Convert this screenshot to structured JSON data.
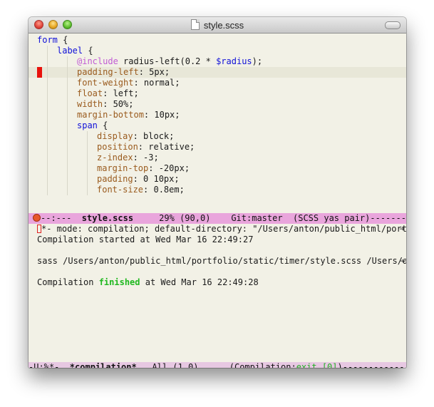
{
  "window": {
    "title": "style.scss"
  },
  "code": {
    "lines": [
      {
        "indent": 0,
        "parts": [
          {
            "t": "form",
            "c": "kw"
          },
          {
            "t": " {"
          }
        ]
      },
      {
        "indent": 1,
        "parts": [
          {
            "t": "label",
            "c": "kw"
          },
          {
            "t": " {"
          }
        ]
      },
      {
        "indent": 2,
        "parts": [
          {
            "t": "@include",
            "c": "inc"
          },
          {
            "t": " radius-left(0.2 * "
          },
          {
            "t": "$radius",
            "c": "var"
          },
          {
            "t": ");"
          }
        ]
      },
      {
        "indent": 2,
        "hl": true,
        "marker": true,
        "parts": [
          {
            "t": "padding-left",
            "c": "prop"
          },
          {
            "t": ": 5px;"
          }
        ]
      },
      {
        "indent": 2,
        "parts": [
          {
            "t": "font-weight",
            "c": "prop"
          },
          {
            "t": ": normal;"
          }
        ]
      },
      {
        "indent": 2,
        "parts": [
          {
            "t": "float",
            "c": "prop"
          },
          {
            "t": ": left;"
          }
        ]
      },
      {
        "indent": 2,
        "parts": [
          {
            "t": "width",
            "c": "prop"
          },
          {
            "t": ": 50%;"
          }
        ]
      },
      {
        "indent": 2,
        "parts": [
          {
            "t": "margin-bottom",
            "c": "prop"
          },
          {
            "t": ": 10px;"
          }
        ]
      },
      {
        "indent": 2,
        "parts": [
          {
            "t": "span",
            "c": "kw"
          },
          {
            "t": " {"
          }
        ]
      },
      {
        "indent": 3,
        "parts": [
          {
            "t": "display",
            "c": "prop"
          },
          {
            "t": ": block;"
          }
        ]
      },
      {
        "indent": 3,
        "parts": [
          {
            "t": "position",
            "c": "prop"
          },
          {
            "t": ": relative;"
          }
        ]
      },
      {
        "indent": 3,
        "parts": [
          {
            "t": "z-index",
            "c": "prop"
          },
          {
            "t": ": -3;"
          }
        ]
      },
      {
        "indent": 3,
        "parts": [
          {
            "t": "margin-top",
            "c": "prop"
          },
          {
            "t": ": -20px;"
          }
        ]
      },
      {
        "indent": 3,
        "parts": [
          {
            "t": "padding",
            "c": "prop"
          },
          {
            "t": ": 0 10px;"
          }
        ]
      },
      {
        "indent": 3,
        "parts": [
          {
            "t": "font-size",
            "c": "prop"
          },
          {
            "t": ": 0.8em;"
          }
        ]
      }
    ]
  },
  "modeline_top": {
    "prefix": "--:---  ",
    "buffer": "style.scss",
    "position": "     29% (90,0)    Git:master  (SCSS yas pair)-------------------"
  },
  "compilation": {
    "header_text": "*- mode: compilation; default-directory: \"/Users/anton/public_html/port",
    "started": "Compilation started at Wed Mar 16 22:49:27",
    "command": "sass /Users/anton/public_html/portfolio/static/timer/style.scss /Users/a",
    "finished_prefix": "Compilation ",
    "finished_word": "finished",
    "finished_suffix": " at Wed Mar 16 22:49:28",
    "wrap_arrow": "➔"
  },
  "modeline_bottom": {
    "prefix": "-U:%*-  ",
    "buffer": "*compilation*",
    "position": "   All (1,0)      (Compilation:",
    "exit_word": "exit",
    "exit_code": " [0]",
    "suffix": ")-------------------------"
  }
}
